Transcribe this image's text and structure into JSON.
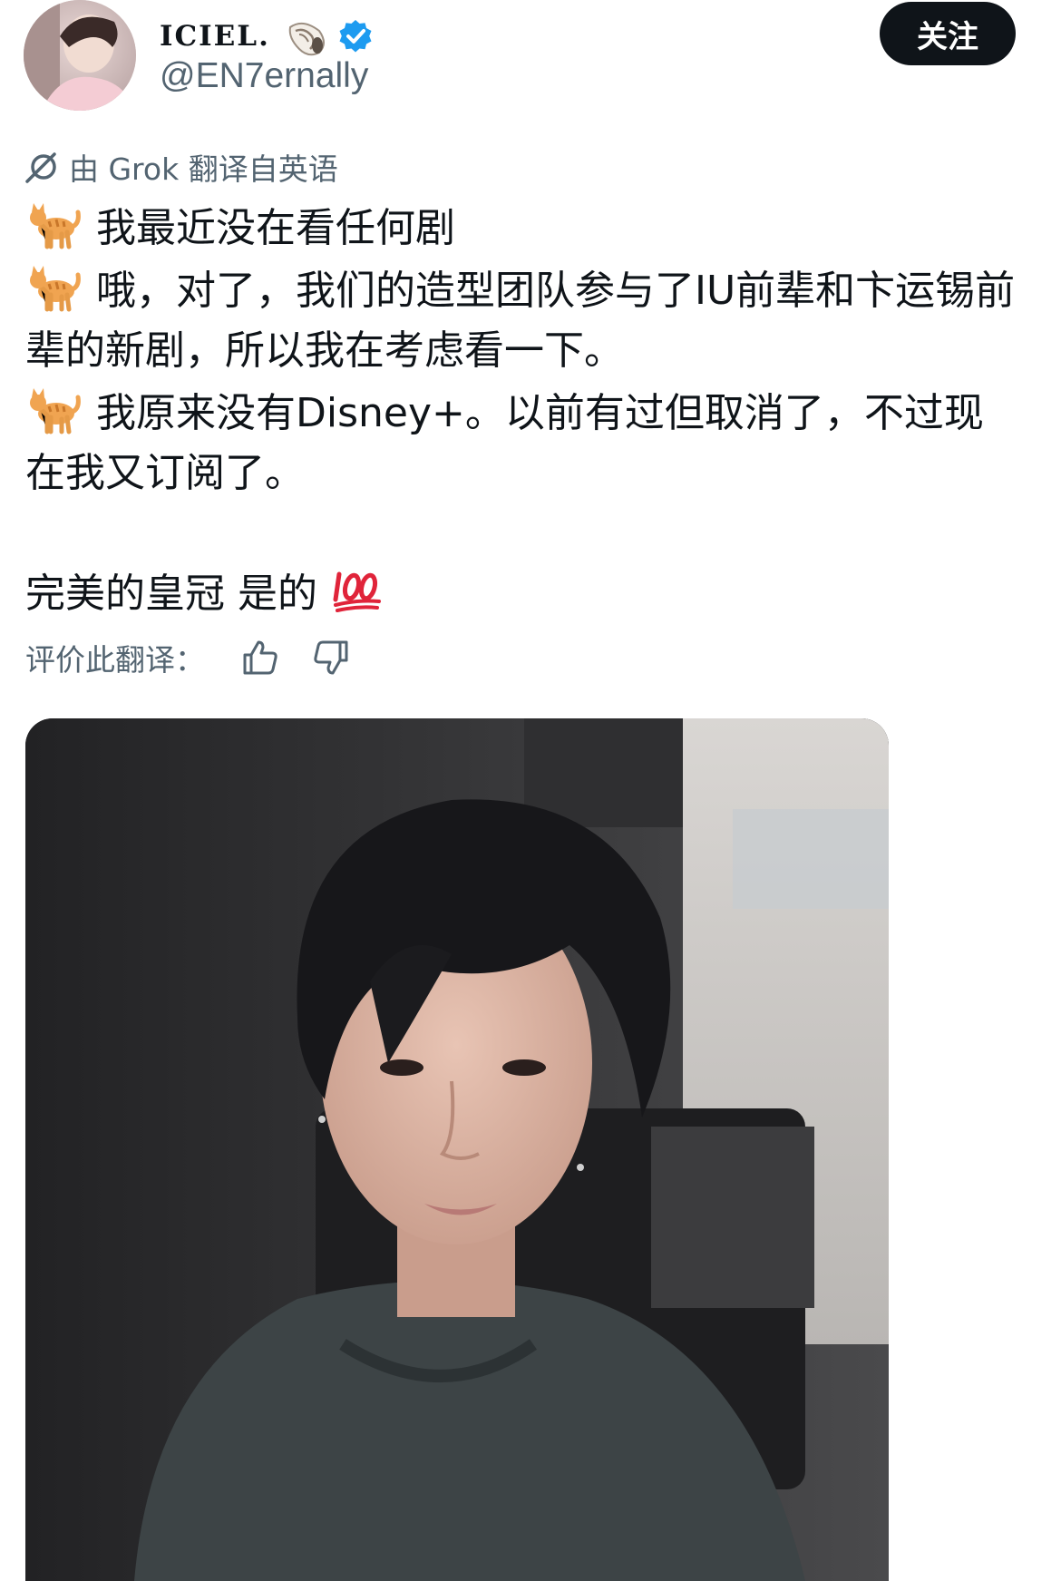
{
  "header": {
    "display_name": "ICIEL.",
    "handle": "@EN7ernally",
    "follow_label": "关注",
    "icons": [
      "avatar",
      "shell-emoji-icon",
      "verified-badge-icon"
    ]
  },
  "translation": {
    "label": "由 Grok 翻译自英语",
    "icon": "grok-icon"
  },
  "tweet": {
    "line1": "我最近没在看任何剧",
    "line2": "哦，对了，我们的造型团队参与了IU前辈和卞运锡前辈的新剧，所以我在考虑看一下。",
    "line3": "我原来没有Disney+。以前有过但取消了，不过现在我又订阅了。",
    "line4": "完美的皇冠 是的",
    "icons": [
      "cat-emoji-icon",
      "hundred-points-emoji-icon"
    ]
  },
  "rating": {
    "label": "评价此翻译：",
    "icons": [
      "thumbs-up-icon",
      "thumbs-down-icon"
    ]
  },
  "media": {
    "type": "photo",
    "icon": "photo"
  },
  "colors": {
    "text": "#0f1419",
    "secondary_text": "#536471",
    "button_bg": "#0f1419",
    "button_text": "#ffffff",
    "verified": "#1d9bf0"
  }
}
